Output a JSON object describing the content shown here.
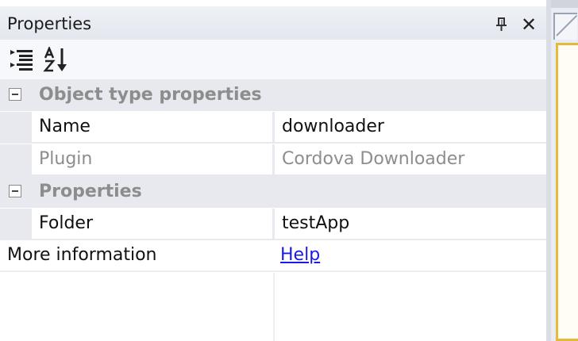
{
  "panel": {
    "title": "Properties",
    "pin_icon": "pin-icon",
    "close_icon": "close-icon"
  },
  "toolbar": {
    "buttons": [
      {
        "icon": "categorized-icon",
        "tooltip": ""
      },
      {
        "icon": "sort-alphabetical-icon",
        "tooltip": ""
      }
    ]
  },
  "grid": {
    "categories": [
      {
        "label": "Object type properties",
        "expanded": true,
        "rows": [
          {
            "name": "Name",
            "value": "downloader",
            "readonly": false
          },
          {
            "name": "Plugin",
            "value": "Cordova Downloader",
            "readonly": true
          }
        ]
      },
      {
        "label": "Properties",
        "expanded": true,
        "rows": [
          {
            "name": "Folder",
            "value": "testApp",
            "readonly": false
          }
        ]
      }
    ],
    "info": {
      "name": "More information",
      "link": "Help"
    }
  },
  "colors": {
    "category_background": "#e7e9ee",
    "readonly_text": "#8d8d8d",
    "link": "#1a1ae6"
  }
}
